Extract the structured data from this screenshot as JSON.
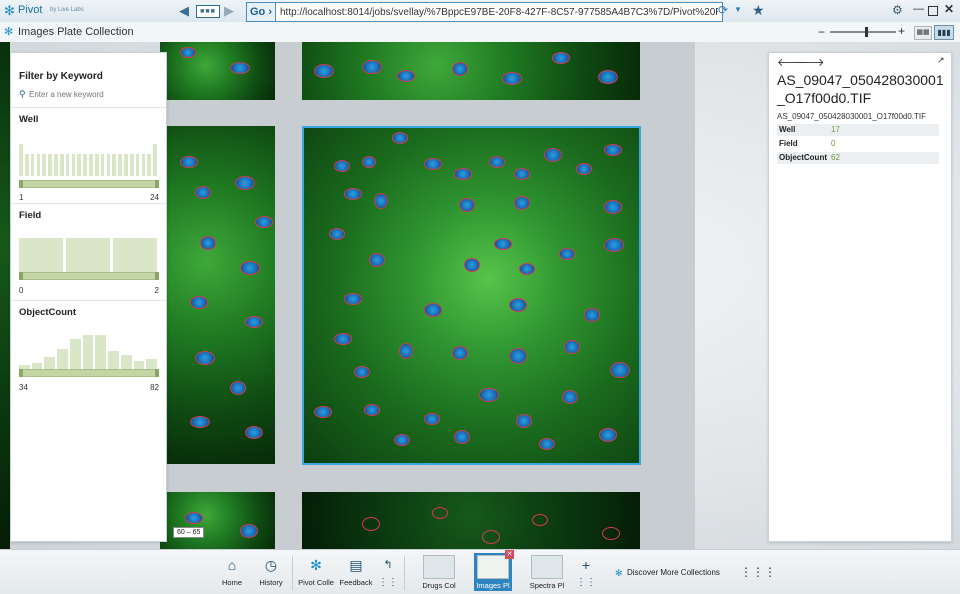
{
  "app": {
    "name": "Pivot",
    "by": "by Live Labs"
  },
  "browser": {
    "go_label": "Go ›",
    "address": "http://localhost:8014/jobs/svellay/%7BppcE97BE-20F8-427F-8C57-977585A4B7C3%7D/Pivot%20Report"
  },
  "toolbar": {
    "collection_title": "Images Plate Collection"
  },
  "filter_panel": {
    "title": "Filter by Keyword",
    "search_placeholder": "Enter a new keyword",
    "facets": [
      {
        "name": "Well",
        "min": "1",
        "max": "24",
        "bars": [
          0.8,
          0.55,
          0.55,
          0.55,
          0.55,
          0.55,
          0.55,
          0.55,
          0.55,
          0.55,
          0.55,
          0.55,
          0.55,
          0.55,
          0.55,
          0.55,
          0.55,
          0.55,
          0.55,
          0.55,
          0.55,
          0.55,
          0.55,
          0.8
        ]
      },
      {
        "name": "Field",
        "min": "0",
        "max": "2",
        "bars": [
          0.85,
          0.85,
          0.85
        ]
      },
      {
        "name": "ObjectCount",
        "min": "34",
        "max": "82",
        "bars": [
          0.1,
          0.15,
          0.3,
          0.5,
          0.75,
          0.85,
          0.85,
          0.45,
          0.35,
          0.2,
          0.25
        ]
      }
    ]
  },
  "tooltip": "60 – 65",
  "info_panel": {
    "title": "AS_09047_050428030001_O17f00d0.TIF",
    "subtitle": "AS_09047_050428030001_O17f00d0.TIF",
    "rows": [
      {
        "key": "Well",
        "value": "17"
      },
      {
        "key": "Field",
        "value": "0"
      },
      {
        "key": "ObjectCount",
        "value": "62"
      }
    ]
  },
  "taskbar": {
    "home": "Home",
    "history": "History",
    "pivot_collections": "Pivot Colle",
    "feedback": "Feedback",
    "collections": [
      {
        "label": "Drugs Col"
      },
      {
        "label": "Images Pl"
      },
      {
        "label": "Spectra Pl"
      }
    ],
    "discover": "Discover More Collections"
  },
  "colors": {
    "accent": "#1c8fc7",
    "selected_border": "#3aa8e0",
    "facet_value": "#6f9a3a"
  },
  "icons": [
    "back-arrow-icon",
    "grid-nav-icon",
    "forward-arrow-icon",
    "refresh-icon",
    "star-icon",
    "gear-icon",
    "minimize-icon",
    "maximize-icon",
    "close-icon",
    "search-icon",
    "home-icon",
    "history-icon",
    "pivot-icon",
    "feedback-icon",
    "add-icon",
    "apps-icon"
  ]
}
